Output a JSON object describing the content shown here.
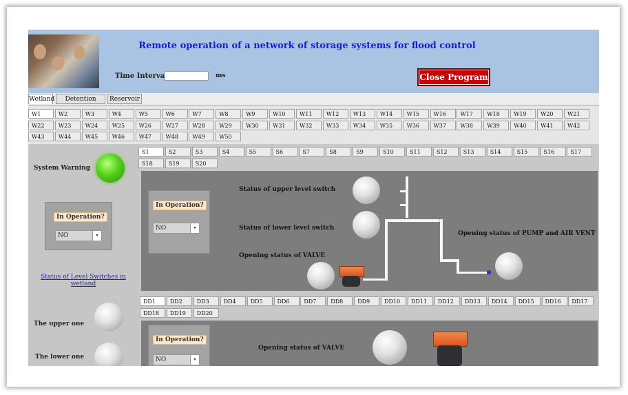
{
  "header": {
    "title": "Remote operation of a network of storage systems for flood control",
    "time_interval_label": "Time Interval",
    "time_interval_value": "",
    "time_interval_unit": "ms",
    "close_label": "Close Program"
  },
  "main_tabs": [
    "Wetland",
    "Detention Pond",
    "Reservoir"
  ],
  "wetland_buttons": [
    "W1",
    "W2",
    "W3",
    "W4",
    "W5",
    "W6",
    "W7",
    "W8",
    "W9",
    "W10",
    "W11",
    "W12",
    "W13",
    "W14",
    "W15",
    "W16",
    "W17",
    "W18",
    "W19",
    "W20",
    "W21",
    "W22",
    "W23",
    "W24",
    "W25",
    "W26",
    "W27",
    "W28",
    "W29",
    "W30",
    "W31",
    "W32",
    "W33",
    "W34",
    "W35",
    "W36",
    "W37",
    "W38",
    "W39",
    "W40",
    "W41",
    "W42",
    "W43",
    "W44",
    "W45",
    "W46",
    "W47",
    "W48",
    "W49",
    "W50"
  ],
  "s_buttons": [
    "S1",
    "S2",
    "S3",
    "S4",
    "S5",
    "S6",
    "S7",
    "S8",
    "S9",
    "S10",
    "S11",
    "S12",
    "S13",
    "S14",
    "S15",
    "S16",
    "S17",
    "S18",
    "S19",
    "S20"
  ],
  "dd_buttons": [
    "DD1",
    "DD2",
    "DD3",
    "DD4",
    "DD5",
    "DD6",
    "DD7",
    "DD8",
    "DD9",
    "DD10",
    "DD11",
    "DD12",
    "DD13",
    "DD14",
    "DD15",
    "DD16",
    "DD17",
    "DD18",
    "DD19",
    "DD20"
  ],
  "left": {
    "system_warning": "System Warning",
    "in_operation": "In Operation?",
    "in_operation_value": "NO",
    "level_switch_link": "Status of Level Switches in wetland",
    "upper_one": "The upper one",
    "lower_one": "The lower one"
  },
  "s_panel": {
    "in_operation": "In Operation?",
    "in_operation_value": "NO",
    "upper_switch": "Status of upper level switch",
    "lower_switch": "Status of lower level switch",
    "valve": "Opening status of VALVE",
    "pump": "Opening status of PUMP and AIR VENT"
  },
  "dd_panel": {
    "in_operation": "In Operation?",
    "in_operation_value": "NO",
    "valve": "Opening status of VALVE"
  }
}
